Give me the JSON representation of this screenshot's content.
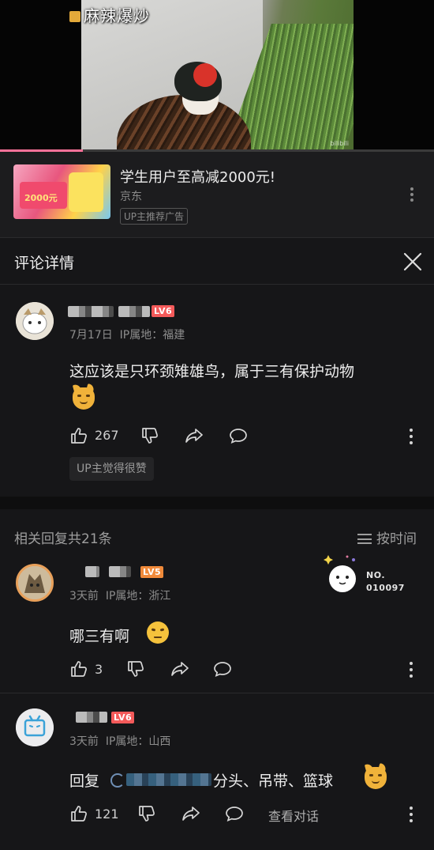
{
  "video": {
    "caption": "麻辣爆炒",
    "watermark": "bilibili",
    "progress_fraction": 0.19
  },
  "ad": {
    "thumb_text": "2000元",
    "title": "学生用户至高减2000元!",
    "brand": "京东",
    "tag": "UP主推荐广告"
  },
  "header": {
    "title": "评论详情"
  },
  "main_comment": {
    "level": "LV6",
    "date": "7月17日",
    "ip": "IP属地：福建",
    "text": "这应该是只环颈雉雄鸟，属于三有保护动物",
    "likes": "267",
    "up_badge": "UP主觉得很赞"
  },
  "replies": {
    "title": "相关回复共21条",
    "sort_label": "按时间",
    "items": [
      {
        "level": "LV5",
        "time": "3天前",
        "ip": "IP属地：浙江",
        "text": "哪三有啊",
        "likes": "3",
        "decoration_text": "NO.\n010097"
      },
      {
        "level": "LV6",
        "time": "3天前",
        "ip": "IP属地：山西",
        "text_prefix": "回复",
        "text_suffix": "分头、吊带、篮球",
        "likes": "121",
        "view_conversation": "查看对话"
      }
    ]
  },
  "colors": {
    "accent": "#fb7299",
    "level_badge": "#f45a5a",
    "background": "#161618"
  },
  "icons": [
    "like-icon",
    "dislike-icon",
    "share-icon",
    "comment-icon",
    "more-icon",
    "close-icon",
    "sort-icon"
  ]
}
